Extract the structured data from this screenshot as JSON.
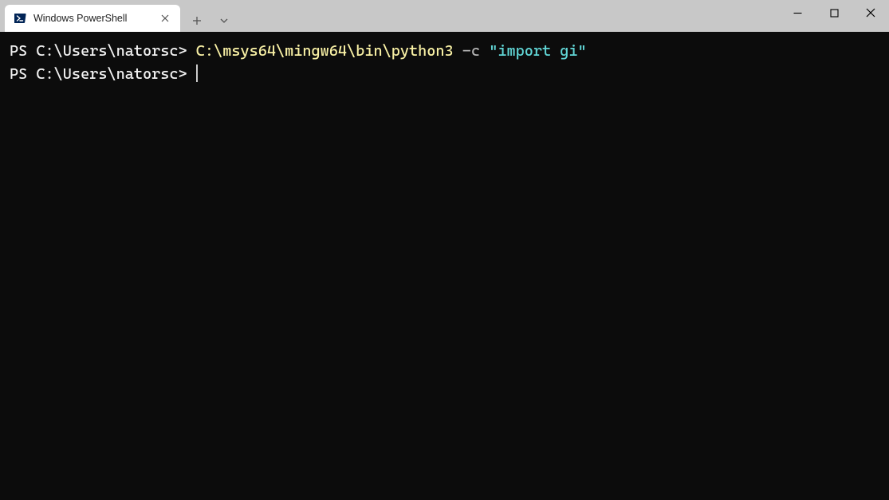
{
  "window": {
    "tab_title": "Windows PowerShell"
  },
  "terminal": {
    "lines": [
      {
        "prompt": "PS C:\\Users\\natorsc>",
        "command_path": "C:\\msys64\\mingw64\\bin\\python3",
        "command_flag": "-c",
        "command_string": "\"import gi\""
      },
      {
        "prompt": "PS C:\\Users\\natorsc>",
        "command_path": "",
        "command_flag": "",
        "command_string": ""
      }
    ]
  }
}
